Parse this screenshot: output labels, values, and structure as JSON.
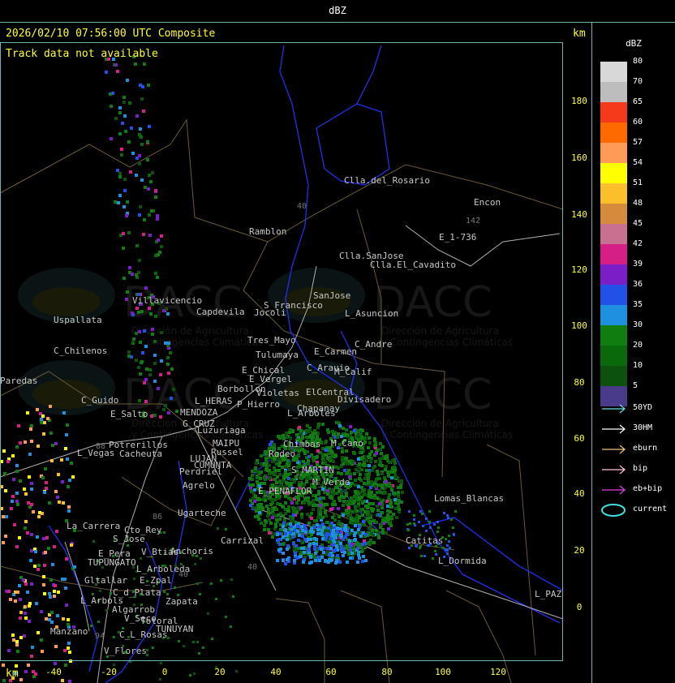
{
  "header": {
    "product": "dBZ",
    "timestamp": "2026/02/10 07:56:00 UTC Composite",
    "track_status": "Track data not available",
    "unit_top": "km",
    "unit_bottom": "km"
  },
  "axes": {
    "x_ticks": [
      "-40",
      "-20",
      "0",
      "20",
      "40",
      "60",
      "80",
      "100",
      "120"
    ],
    "y_ticks": [
      "180",
      "160",
      "140",
      "120",
      "100",
      "80",
      "60",
      "40",
      "20",
      "0"
    ]
  },
  "legend": {
    "title": "dBZ",
    "scale": [
      {
        "label": "80",
        "color": "#d8d8d8"
      },
      {
        "label": "70",
        "color": "#bdbdbd"
      },
      {
        "label": "65",
        "color": "#f53a1b"
      },
      {
        "label": "60",
        "color": "#ff6a00"
      },
      {
        "label": "57",
        "color": "#ff9a57"
      },
      {
        "label": "54",
        "color": "#ffff00"
      },
      {
        "label": "51",
        "color": "#fbbf2c"
      },
      {
        "label": "48",
        "color": "#d68a3c"
      },
      {
        "label": "45",
        "color": "#c87090"
      },
      {
        "label": "42",
        "color": "#d61f86"
      },
      {
        "label": "39",
        "color": "#7a1ec8"
      },
      {
        "label": "36",
        "color": "#2251e8"
      },
      {
        "label": "35",
        "color": "#1e90dd"
      },
      {
        "label": "30",
        "color": "#0f7d0f"
      },
      {
        "label": "20",
        "color": "#0a690a"
      },
      {
        "label": "10",
        "color": "#0c520c"
      },
      {
        "label": "5",
        "color": "#4a3b8a"
      }
    ],
    "tracks": [
      {
        "label": "50YD",
        "color": "#66e0e0"
      },
      {
        "label": "30HM",
        "color": "#ffffff"
      },
      {
        "label": "eburn",
        "color": "#f0c080"
      },
      {
        "label": "bip",
        "color": "#ffc0e0"
      },
      {
        "label": "eb+bip",
        "color": "#e040e0"
      },
      {
        "label": "current",
        "color": "#40e0e0"
      }
    ]
  },
  "watermark": {
    "brand": "DACC",
    "line1": "Dirección de Agricultura",
    "line2": "y Contingencias Climáticas"
  },
  "places": [
    {
      "name": "Clla.del_Rosario"
    },
    {
      "name": "Encon"
    },
    {
      "name": "E_1-736"
    },
    {
      "name": "Ramblon"
    },
    {
      "name": "Clla.SanJose"
    },
    {
      "name": "Clla.El_Cavadito"
    },
    {
      "name": "SanJose"
    },
    {
      "name": "S_Francisco"
    },
    {
      "name": "L_Asuncion"
    },
    {
      "name": "Villavicencio"
    },
    {
      "name": "Capdevila"
    },
    {
      "name": "Jocoli"
    },
    {
      "name": "Uspallata"
    },
    {
      "name": "Tres_Mayo"
    },
    {
      "name": "C_Andre"
    },
    {
      "name": "E_Carmen"
    },
    {
      "name": "C_Chilenos"
    },
    {
      "name": "Tulumaya"
    },
    {
      "name": "C_Arauio"
    },
    {
      "name": "M_Calif"
    },
    {
      "name": "E_Chical"
    },
    {
      "name": "E_Vergel"
    },
    {
      "name": "Paredas"
    },
    {
      "name": "Borbollon"
    },
    {
      "name": "ElCentral"
    },
    {
      "name": "Divisadero"
    },
    {
      "name": "C_Guido"
    },
    {
      "name": "L_HERAS"
    },
    {
      "name": "Violetas"
    },
    {
      "name": "P_Hierro"
    },
    {
      "name": "L_Arboles"
    },
    {
      "name": "E_Salto"
    },
    {
      "name": "MENDOZA"
    },
    {
      "name": "G_CRUZ"
    },
    {
      "name": "Chapanay"
    },
    {
      "name": "Luzuriaga"
    },
    {
      "name": "Chimbas"
    },
    {
      "name": "Potrerillos"
    },
    {
      "name": "MAIPU"
    },
    {
      "name": "M_Cano"
    },
    {
      "name": "L_Vegas"
    },
    {
      "name": "Cacheuta"
    },
    {
      "name": "Russel"
    },
    {
      "name": "Rodeo"
    },
    {
      "name": "LUJAN"
    },
    {
      "name": "CUMUNTA"
    },
    {
      "name": "S_MARTIN"
    },
    {
      "name": "Perdriel"
    },
    {
      "name": "M_Verde"
    },
    {
      "name": "Agrelo"
    },
    {
      "name": "E_PENAFLOR"
    },
    {
      "name": "Lomas_Blancas"
    },
    {
      "name": "Ugarteche"
    },
    {
      "name": "La_Carrera"
    },
    {
      "name": "Cto_Rey"
    },
    {
      "name": "S_Jose"
    },
    {
      "name": "Carrizal"
    },
    {
      "name": "Catitas"
    },
    {
      "name": "E_Pera"
    },
    {
      "name": "V_Btias"
    },
    {
      "name": "Anchoris"
    },
    {
      "name": "TUPUNGATO"
    },
    {
      "name": "L_Dormida"
    },
    {
      "name": "L_Arboleda"
    },
    {
      "name": "Gltallar"
    },
    {
      "name": "E_Zpal"
    },
    {
      "name": "L_PAZ"
    },
    {
      "name": "C_d_Plata"
    },
    {
      "name": "L_Arbols"
    },
    {
      "name": "Zapata"
    },
    {
      "name": "Algarrob"
    },
    {
      "name": "V_Seco"
    },
    {
      "name": "Totoral"
    },
    {
      "name": "TUNUYAN"
    },
    {
      "name": "Manzano"
    },
    {
      "name": "C_L_Rosas"
    },
    {
      "name": "V_Flores"
    }
  ],
  "road_markers": [
    {
      "label": "40"
    },
    {
      "label": "142"
    },
    {
      "label": "88"
    },
    {
      "label": "86"
    },
    {
      "label": "40"
    },
    {
      "label": "94"
    },
    {
      "label": "40"
    }
  ]
}
